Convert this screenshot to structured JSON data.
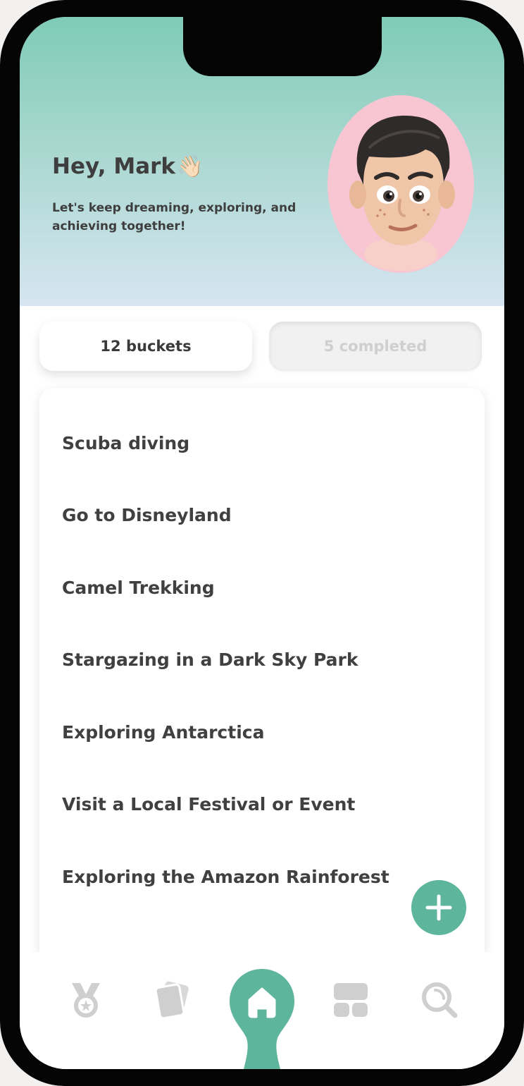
{
  "header": {
    "greeting": "Hey, Mark",
    "greeting_emoji": "👋🏻",
    "subtitle": "Let's keep dreaming, exploring, and achieving together!",
    "avatar_icon": "memoji-avatar-icon"
  },
  "stats": {
    "buckets_label": "12 buckets",
    "completed_label": "5 completed"
  },
  "bucket_list": [
    "Scuba diving",
    "Go to Disneyland",
    "Camel Trekking",
    "Stargazing in a Dark Sky Park",
    "Exploring Antarctica",
    "Visit a Local Festival or Event",
    "Exploring the Amazon Rainforest"
  ],
  "fab": {
    "icon": "plus-icon"
  },
  "bottom_nav": {
    "items": [
      {
        "icon": "medal-icon",
        "active": false
      },
      {
        "icon": "cards-icon",
        "active": false
      },
      {
        "icon": "home-icon",
        "active": true
      },
      {
        "icon": "grid-icon",
        "active": false
      },
      {
        "icon": "search-icon",
        "active": false
      }
    ]
  },
  "colors": {
    "accent": "#5db59b",
    "header_top": "#7fcbb7",
    "header_bottom": "#d6e5f1",
    "avatar_bg": "#f8c6d2",
    "inactive_icon": "#cfcfcf",
    "text_dark": "#3e3e3e"
  }
}
